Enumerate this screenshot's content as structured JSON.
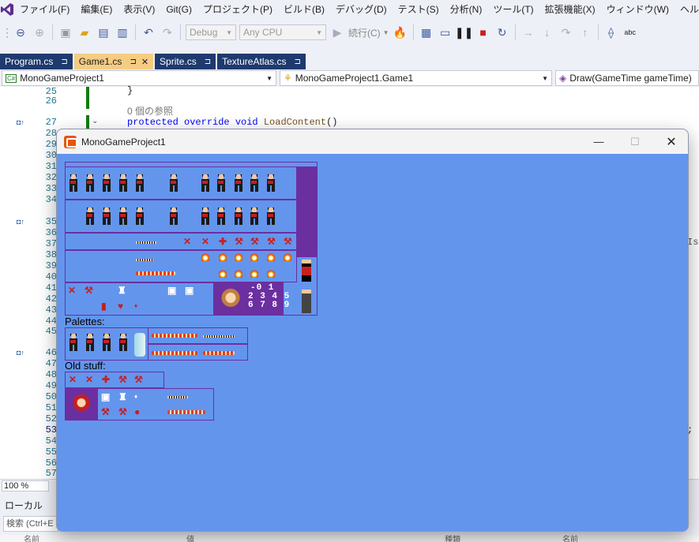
{
  "menubar": {
    "items": [
      "ファイル(F)",
      "編集(E)",
      "表示(V)",
      "Git(G)",
      "プロジェクト(P)",
      "ビルド(B)",
      "デバッグ(D)",
      "テスト(S)",
      "分析(N)",
      "ツール(T)",
      "拡張機能(X)",
      "ウィンドウ(W)",
      "ヘルプ(H)"
    ]
  },
  "toolbar": {
    "config": "Debug",
    "platform": "Any CPU",
    "continue_label": "続行(C)",
    "abc_label": "abc"
  },
  "tabs": [
    {
      "label": "Program.cs",
      "pin": "⊐"
    },
    {
      "label": "Game1.cs",
      "pin": "⊐",
      "close": "✕"
    },
    {
      "label": "Sprite.cs",
      "pin": "⊐"
    },
    {
      "label": "TextureAtlas.cs",
      "pin": "⊐"
    }
  ],
  "nav": {
    "project": "MonoGameProject1",
    "type": "MonoGameProject1.Game1",
    "member": "Draw(GameTime gameTime)"
  },
  "editor": {
    "line_numbers": [
      "25",
      "26",
      "27",
      "28",
      "29",
      "30",
      "31",
      "32",
      "33",
      "34",
      "35",
      "36",
      "37",
      "38",
      "39",
      "40",
      "41",
      "42",
      "43",
      "44",
      "45",
      "46",
      "47",
      "48",
      "49",
      "50",
      "51",
      "52",
      "53",
      "54",
      "55",
      "56",
      "57"
    ],
    "brace": "}",
    "ref_count": "0 個の参照",
    "kw_protected": "protected",
    "kw_override": "override",
    "kw_void": "void",
    "method": "LoadContent",
    "parens": "()",
    "clipped_right": "Isl",
    "clipped_semicolon": ";"
  },
  "status": {
    "zoom": "100 %"
  },
  "locals_panel": {
    "title": "ローカル",
    "search_placeholder": "検索 (Ctrl+E",
    "col_name": "名前",
    "col_value": "値",
    "col_type": "種類",
    "col_name2": "名前"
  },
  "game_window": {
    "title": "MonoGameProject1",
    "background": "#6495ed",
    "sections": {
      "palettes": "Palettes:",
      "old_stuff": "Old stuff:"
    },
    "digits_row1": "-0 1",
    "digits_row2": "2 3 4 5",
    "digits_row3": "6 7 8 9"
  },
  "colors": {
    "accent_tab": "#f5cc84",
    "tab_inactive": "#1e3a6e",
    "atlas_border": "#6b2fa0",
    "keyword": "#0000ff",
    "linenum": "#237893"
  }
}
